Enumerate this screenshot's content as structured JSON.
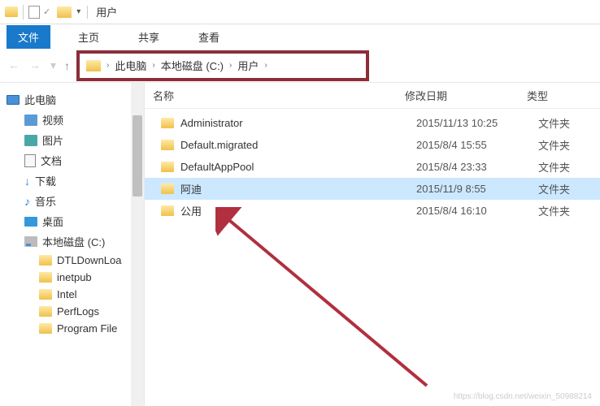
{
  "window": {
    "title": "用户"
  },
  "ribbon": {
    "tabs": [
      "文件",
      "主页",
      "共享",
      "查看"
    ],
    "active_index": 0
  },
  "breadcrumb": {
    "items": [
      "此电脑",
      "本地磁盘 (C:)",
      "用户"
    ]
  },
  "sidebar": {
    "items": [
      {
        "label": "此电脑",
        "icon": "pc",
        "indent": 0
      },
      {
        "label": "视频",
        "icon": "generic",
        "indent": 1
      },
      {
        "label": "图片",
        "icon": "pics",
        "indent": 1
      },
      {
        "label": "文档",
        "icon": "doc",
        "indent": 1
      },
      {
        "label": "下载",
        "icon": "down",
        "indent": 1
      },
      {
        "label": "音乐",
        "icon": "music",
        "indent": 1
      },
      {
        "label": "桌面",
        "icon": "desk",
        "indent": 1
      },
      {
        "label": "本地磁盘 (C:)",
        "icon": "disk",
        "indent": 1
      },
      {
        "label": "DTLDownLoa",
        "icon": "folder",
        "indent": 2
      },
      {
        "label": "inetpub",
        "icon": "folder",
        "indent": 2
      },
      {
        "label": "Intel",
        "icon": "folder",
        "indent": 2
      },
      {
        "label": "PerfLogs",
        "icon": "folder",
        "indent": 2
      },
      {
        "label": "Program File",
        "icon": "folder",
        "indent": 2
      }
    ]
  },
  "columns": {
    "name": "名称",
    "date": "修改日期",
    "type": "类型"
  },
  "rows": [
    {
      "name": "Administrator",
      "date": "2015/11/13 10:25",
      "type": "文件夹",
      "selected": false
    },
    {
      "name": "Default.migrated",
      "date": "2015/8/4 15:55",
      "type": "文件夹",
      "selected": false
    },
    {
      "name": "DefaultAppPool",
      "date": "2015/8/4 23:33",
      "type": "文件夹",
      "selected": false
    },
    {
      "name": "阿迪",
      "date": "2015/11/9 8:55",
      "type": "文件夹",
      "selected": true
    },
    {
      "name": "公用",
      "date": "2015/8/4 16:10",
      "type": "文件夹",
      "selected": false
    }
  ],
  "watermark": "https://blog.csdn.net/weixin_50988214"
}
